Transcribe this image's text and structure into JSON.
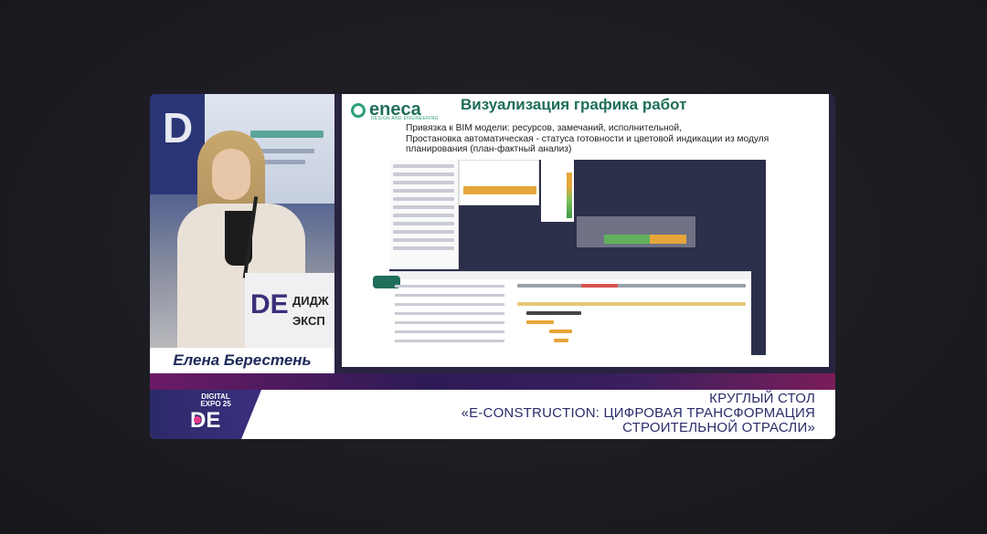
{
  "speaker": {
    "name": "Елена Берестень",
    "podium_text_1": "ДИДЖ",
    "podium_text_2": "ЭКСП"
  },
  "slide": {
    "logo_word": "eneca",
    "logo_sub": "DESIGN AND ENGINEERING",
    "title": "Визуализация графика работ",
    "text_lines": [
      "Привязка к  BIM модели:  ресурсов, замечаний, исполнительной,",
      "Простановка автоматическая - статуса готовности и цветовой индикации из модуля",
      "планирования (план-фактный анализ)"
    ]
  },
  "banner": {
    "event_top": "DIGITAL",
    "event_bottom": "EXPO 25",
    "caption_lines": [
      "КРУГЛЫЙ СТОЛ",
      "«E-CONSTRUCTION: ЦИФРОВАЯ ТРАНСФОРМАЦИЯ",
      "СТРОИТЕЛЬНОЙ ОТРАСЛИ»"
    ]
  },
  "colors": {
    "brand_green": "#1f6e5a",
    "accent_orange": "#e6a63a",
    "banner_text": "#2a2d6a",
    "background": "#1c1c22"
  }
}
